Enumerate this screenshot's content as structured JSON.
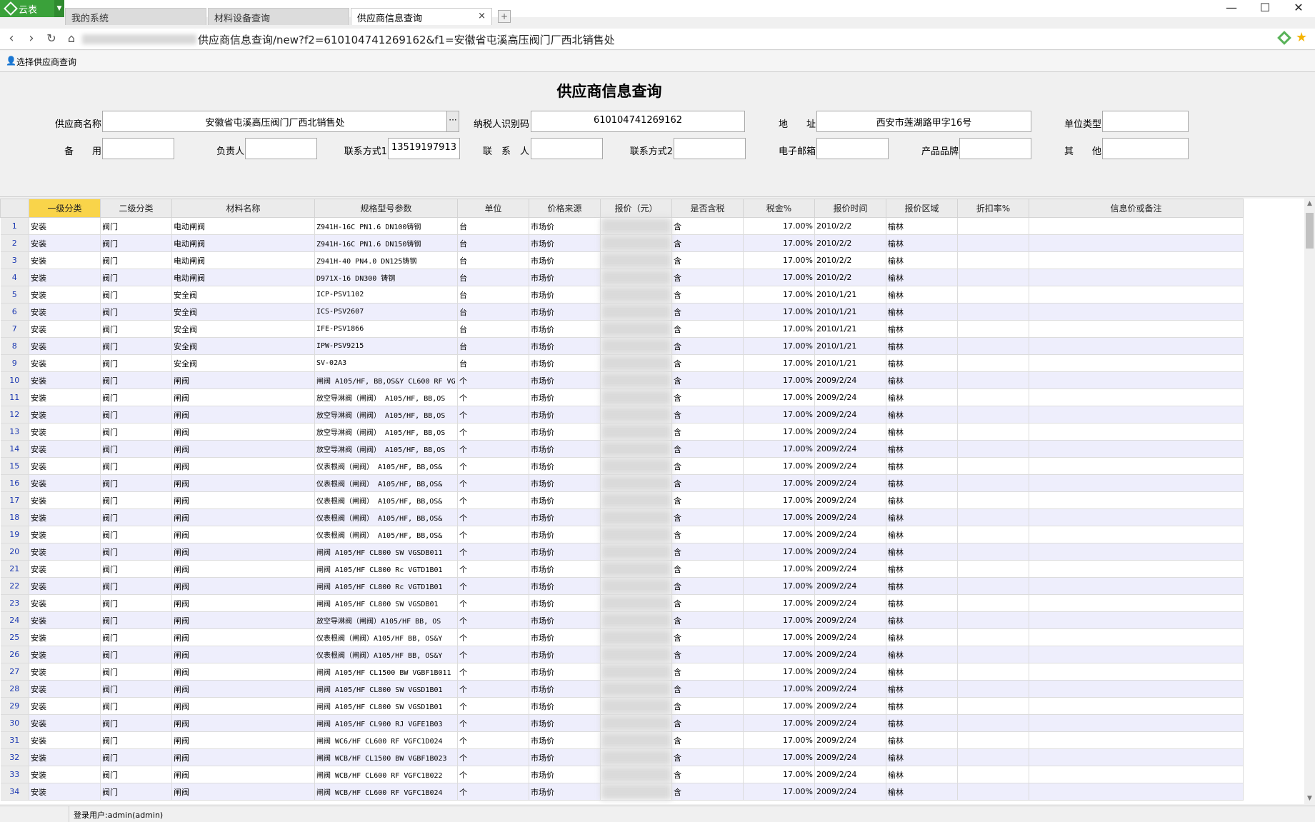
{
  "app": {
    "name": "云表",
    "tabs": [
      {
        "label": "我的系统"
      },
      {
        "label": "材料设备查询"
      },
      {
        "label": "供应商信息查询",
        "close": "×"
      }
    ],
    "new_tab": "+",
    "window": {
      "minimize": "—",
      "maximize": "☐",
      "close": "✕"
    }
  },
  "address": {
    "url": "供应商信息查询/new?f2=610104741269162&f1=安徽省屯溪高压阀门厂西北销售处"
  },
  "toolbar": {
    "select_label": "选择供应商查询"
  },
  "form": {
    "title": "供应商信息查询",
    "labels": {
      "supplier_name": "供应商名称",
      "tax_id": "纳税人识别码",
      "address": "地　　址",
      "unit_type": "单位类型",
      "backup": "备　　用",
      "principal": "负责人",
      "contact1": "联系方式1",
      "contact_person": "联　系　人",
      "contact2": "联系方式2",
      "email": "电子邮箱",
      "brand": "产品品牌",
      "other": "其　　他"
    },
    "values": {
      "supplier_name": "安徽省屯溪高压阀门厂西北销售处",
      "tax_id": "610104741269162",
      "address": "西安市莲湖路甲字16号",
      "unit_type": "",
      "backup": "",
      "principal": "",
      "contact1": "13519197913",
      "contact_person": "",
      "contact2": "",
      "email": "",
      "brand": "",
      "other": ""
    },
    "ellipsis": "···"
  },
  "grid": {
    "columns": [
      "一级分类",
      "二级分类",
      "材料名称",
      "规格型号参数",
      "单位",
      "价格来源",
      "报价（元）",
      "是否含税",
      "税金%",
      "报价时间",
      "报价区域",
      "折扣率%",
      "信息价或备注"
    ],
    "rows": [
      [
        "1",
        "安装",
        "阀门",
        "电动闸阀",
        "Z941H-16C PN1.6 DN100铸钢",
        "台",
        "市场价",
        "",
        "含",
        "17.00%",
        "2010/2/2",
        "榆林",
        "",
        ""
      ],
      [
        "2",
        "安装",
        "阀门",
        "电动闸阀",
        "Z941H-16C PN1.6 DN150铸钢",
        "台",
        "市场价",
        "",
        "含",
        "17.00%",
        "2010/2/2",
        "榆林",
        "",
        ""
      ],
      [
        "3",
        "安装",
        "阀门",
        "电动闸阀",
        "Z941H-40  PN4.0  DN125铸钢",
        "台",
        "市场价",
        "",
        "含",
        "17.00%",
        "2010/2/2",
        "榆林",
        "",
        ""
      ],
      [
        "4",
        "安装",
        "阀门",
        "电动闸阀",
        "D971X-16 DN300 铸钢",
        "台",
        "市场价",
        "",
        "含",
        "17.00%",
        "2010/2/2",
        "榆林",
        "",
        ""
      ],
      [
        "5",
        "安装",
        "阀门",
        "安全阀",
        "ICP-PSV1102",
        "台",
        "市场价",
        "",
        "含",
        "17.00%",
        "2010/1/21",
        "榆林",
        "",
        ""
      ],
      [
        "6",
        "安装",
        "阀门",
        "安全阀",
        "ICS-PSV2607",
        "台",
        "市场价",
        "",
        "含",
        "17.00%",
        "2010/1/21",
        "榆林",
        "",
        ""
      ],
      [
        "7",
        "安装",
        "阀门",
        "安全阀",
        "IFE-PSV1866",
        "台",
        "市场价",
        "",
        "含",
        "17.00%",
        "2010/1/21",
        "榆林",
        "",
        ""
      ],
      [
        "8",
        "安装",
        "阀门",
        "安全阀",
        "IPW-PSV9215",
        "台",
        "市场价",
        "",
        "含",
        "17.00%",
        "2010/1/21",
        "榆林",
        "",
        ""
      ],
      [
        "9",
        "安装",
        "阀门",
        "安全阀",
        "SV-02A3",
        "台",
        "市场价",
        "",
        "含",
        "17.00%",
        "2010/1/21",
        "榆林",
        "",
        ""
      ],
      [
        "10",
        "安装",
        "阀门",
        "闸阀",
        "闸阀 A105/HF, BB,OS&Y CL600 RF VG",
        "个",
        "市场价",
        "",
        "含",
        "17.00%",
        "2009/2/24",
        "榆林",
        "",
        ""
      ],
      [
        "11",
        "安装",
        "阀门",
        "闸阀",
        "放空导淋阀（闸阀） A105/HF, BB,OS",
        "个",
        "市场价",
        "",
        "含",
        "17.00%",
        "2009/2/24",
        "榆林",
        "",
        ""
      ],
      [
        "12",
        "安装",
        "阀门",
        "闸阀",
        "放空导淋阀（闸阀） A105/HF, BB,OS",
        "个",
        "市场价",
        "",
        "含",
        "17.00%",
        "2009/2/24",
        "榆林",
        "",
        ""
      ],
      [
        "13",
        "安装",
        "阀门",
        "闸阀",
        "放空导淋阀（闸阀） A105/HF, BB,OS",
        "个",
        "市场价",
        "",
        "含",
        "17.00%",
        "2009/2/24",
        "榆林",
        "",
        ""
      ],
      [
        "14",
        "安装",
        "阀门",
        "闸阀",
        "放空导淋阀（闸阀） A105/HF, BB,OS",
        "个",
        "市场价",
        "",
        "含",
        "17.00%",
        "2009/2/24",
        "榆林",
        "",
        ""
      ],
      [
        "15",
        "安装",
        "阀门",
        "闸阀",
        "仪表根阀（闸阀） A105/HF, BB,OS&",
        "个",
        "市场价",
        "",
        "含",
        "17.00%",
        "2009/2/24",
        "榆林",
        "",
        ""
      ],
      [
        "16",
        "安装",
        "阀门",
        "闸阀",
        "仪表根阀（闸阀） A105/HF, BB,OS&",
        "个",
        "市场价",
        "",
        "含",
        "17.00%",
        "2009/2/24",
        "榆林",
        "",
        ""
      ],
      [
        "17",
        "安装",
        "阀门",
        "闸阀",
        "仪表根阀（闸阀） A105/HF, BB,OS&",
        "个",
        "市场价",
        "",
        "含",
        "17.00%",
        "2009/2/24",
        "榆林",
        "",
        ""
      ],
      [
        "18",
        "安装",
        "阀门",
        "闸阀",
        "仪表根阀（闸阀） A105/HF, BB,OS&",
        "个",
        "市场价",
        "",
        "含",
        "17.00%",
        "2009/2/24",
        "榆林",
        "",
        ""
      ],
      [
        "19",
        "安装",
        "阀门",
        "闸阀",
        "仪表根阀（闸阀） A105/HF, BB,OS&",
        "个",
        "市场价",
        "",
        "含",
        "17.00%",
        "2009/2/24",
        "榆林",
        "",
        ""
      ],
      [
        "20",
        "安装",
        "阀门",
        "闸阀",
        "闸阀 A105/HF  CL800  SW  VGSDB011",
        "个",
        "市场价",
        "",
        "含",
        "17.00%",
        "2009/2/24",
        "榆林",
        "",
        ""
      ],
      [
        "21",
        "安装",
        "阀门",
        "闸阀",
        "闸阀 A105/HF  CL800  Rc  VGTD1B01",
        "个",
        "市场价",
        "",
        "含",
        "17.00%",
        "2009/2/24",
        "榆林",
        "",
        ""
      ],
      [
        "22",
        "安装",
        "阀门",
        "闸阀",
        "闸阀 A105/HF  CL800  Rc  VGTD1B01",
        "个",
        "市场价",
        "",
        "含",
        "17.00%",
        "2009/2/24",
        "榆林",
        "",
        ""
      ],
      [
        "23",
        "安装",
        "阀门",
        "闸阀",
        "闸阀 A105/HF  CL800  SW  VGSDB01",
        "个",
        "市场价",
        "",
        "含",
        "17.00%",
        "2009/2/24",
        "榆林",
        "",
        ""
      ],
      [
        "24",
        "安装",
        "阀门",
        "闸阀",
        "放空导淋阀（闸阀）A105/HF  BB, OS",
        "个",
        "市场价",
        "",
        "含",
        "17.00%",
        "2009/2/24",
        "榆林",
        "",
        ""
      ],
      [
        "25",
        "安装",
        "阀门",
        "闸阀",
        "仪表根阀（闸阀）A105/HF BB, OS&Y",
        "个",
        "市场价",
        "",
        "含",
        "17.00%",
        "2009/2/24",
        "榆林",
        "",
        ""
      ],
      [
        "26",
        "安装",
        "阀门",
        "闸阀",
        "仪表根阀（闸阀）A105/HF BB, OS&Y",
        "个",
        "市场价",
        "",
        "含",
        "17.00%",
        "2009/2/24",
        "榆林",
        "",
        ""
      ],
      [
        "27",
        "安装",
        "阀门",
        "闸阀",
        "闸阀 A105/HF  CL1500 BW VGBF1B011",
        "个",
        "市场价",
        "",
        "含",
        "17.00%",
        "2009/2/24",
        "榆林",
        "",
        ""
      ],
      [
        "28",
        "安装",
        "阀门",
        "闸阀",
        "闸阀 A105/HF  CL800  SW  VGSD1B01",
        "个",
        "市场价",
        "",
        "含",
        "17.00%",
        "2009/2/24",
        "榆林",
        "",
        ""
      ],
      [
        "29",
        "安装",
        "阀门",
        "闸阀",
        "闸阀 A105/HF  CL800  SW  VGSD1B01",
        "个",
        "市场价",
        "",
        "含",
        "17.00%",
        "2009/2/24",
        "榆林",
        "",
        ""
      ],
      [
        "30",
        "安装",
        "阀门",
        "闸阀",
        "闸阀 A105/HF  CL900  RJ  VGFE1B03",
        "个",
        "市场价",
        "",
        "含",
        "17.00%",
        "2009/2/24",
        "榆林",
        "",
        ""
      ],
      [
        "31",
        "安装",
        "阀门",
        "闸阀",
        "闸阀 WC6/HF  CL600  RF  VGFC1D024",
        "个",
        "市场价",
        "",
        "含",
        "17.00%",
        "2009/2/24",
        "榆林",
        "",
        ""
      ],
      [
        "32",
        "安装",
        "阀门",
        "闸阀",
        "闸阀 WCB/HF  CL1500  BW VGBF1B023",
        "个",
        "市场价",
        "",
        "含",
        "17.00%",
        "2009/2/24",
        "榆林",
        "",
        ""
      ],
      [
        "33",
        "安装",
        "阀门",
        "闸阀",
        "闸阀 WCB/HF  CL600  RF  VGFC1B022",
        "个",
        "市场价",
        "",
        "含",
        "17.00%",
        "2009/2/24",
        "榆林",
        "",
        ""
      ],
      [
        "34",
        "安装",
        "阀门",
        "闸阀",
        "闸阀 WCB/HF  CL600  RF  VGFC1B024",
        "个",
        "市场价",
        "",
        "含",
        "17.00%",
        "2009/2/24",
        "榆林",
        "",
        ""
      ]
    ]
  },
  "status": {
    "user": "登录用户:admin(admin)"
  }
}
